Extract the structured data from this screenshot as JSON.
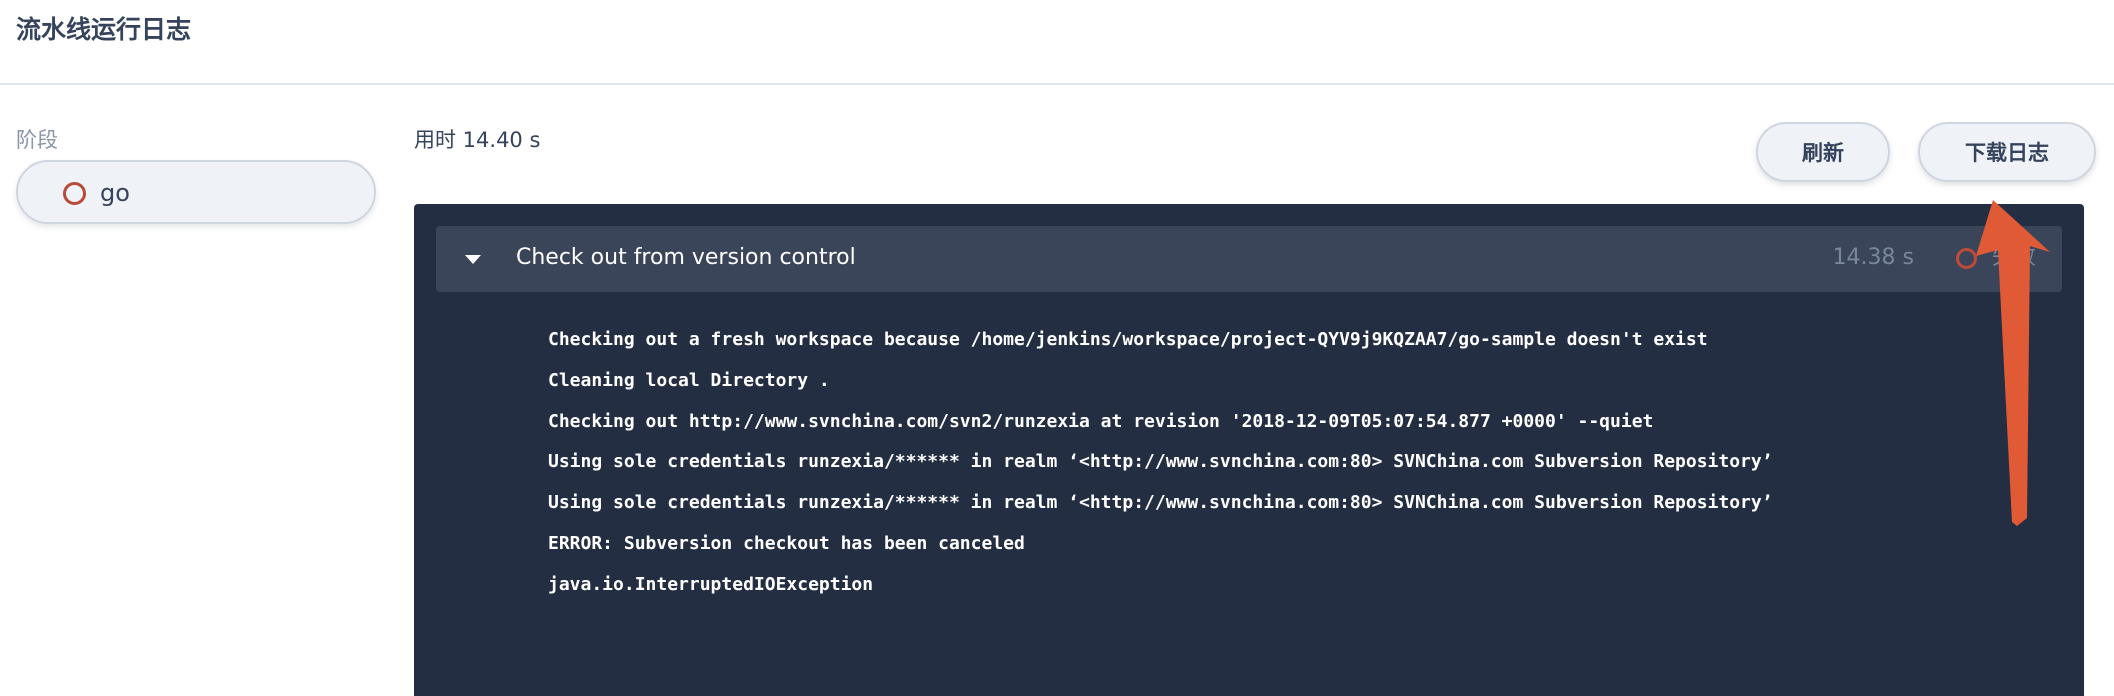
{
  "header": {
    "title": "流水线运行日志"
  },
  "sidebar": {
    "stage_label": "阶段",
    "stages": [
      {
        "name": "go",
        "status_icon": "failed-ring-icon"
      }
    ]
  },
  "main": {
    "duration": "用时 14.40 s",
    "toolbar": {
      "refresh_label": "刷新",
      "download_label": "下载日志"
    },
    "log": {
      "step": {
        "title": "Check out from version control",
        "time": "14.38 s",
        "status": "失败",
        "expanded": true
      },
      "lines": [
        "Checking out a fresh workspace because /home/jenkins/workspace/project-QYV9j9KQZAA7/go-sample doesn't exist",
        "Cleaning local Directory .",
        "Checking out http://www.svnchina.com/svn2/runzexia at revision '2018-12-09T05:07:54.877 +0000' --quiet",
        "Using sole credentials runzexia/****** in realm ‘<http://www.svnchina.com:80> SVNChina.com Subversion Repository’",
        "Using sole credentials runzexia/****** in realm ‘<http://www.svnchina.com:80> SVNChina.com Subversion Repository’",
        "ERROR: Subversion checkout has been canceled",
        "java.io.InterruptedIOException"
      ]
    }
  },
  "colors": {
    "failed": "#b84a39",
    "log_background": "#242e42",
    "step_header_background": "#3b4559",
    "annotation_arrow": "#e05a35"
  }
}
